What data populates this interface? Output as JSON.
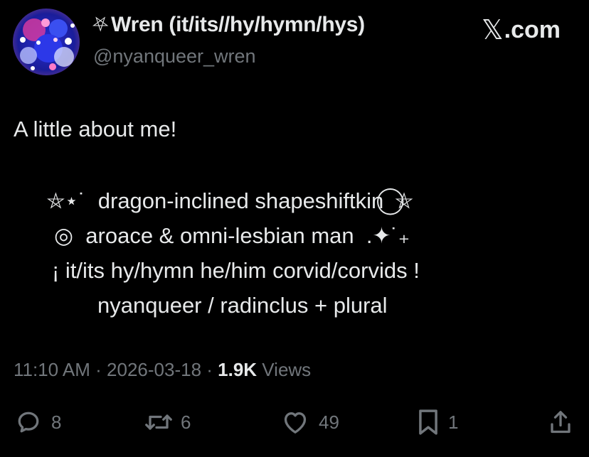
{
  "colors": {
    "background": "#000000",
    "primary_text": "#e7e9ea",
    "secondary_text": "#71767b"
  },
  "author": {
    "pentagram": "⛧",
    "display_name": "Wren (it/its//hy/hymn/hys)",
    "handle": "@nyanqueer_wren"
  },
  "brand": {
    "x_glyph": "𝕏",
    "suffix": ".com"
  },
  "tweet": {
    "text": "A little about me!",
    "bio_lines": [
      "⛤⋆˙  dragon-inclined shapeshiftkin  ⃝⛤",
      "◎  aroace & omni-lesbian man  .✦˙₊",
      "¡ it/its hy/hymn he/him corvid/corvids !",
      "nyanqueer / radinclus + plural"
    ]
  },
  "meta": {
    "time": "11:10 AM",
    "separator": " · ",
    "date": "2026-03-18",
    "views_count": "1.9K",
    "views_label": " Views"
  },
  "actions": {
    "replies": "8",
    "reposts": "6",
    "likes": "49",
    "bookmarks": "1"
  },
  "icons": {
    "reply": "speech-bubble-icon",
    "repost": "repost-arrows-icon",
    "like": "heart-icon",
    "bookmark": "bookmark-icon",
    "share": "share-upload-icon"
  }
}
